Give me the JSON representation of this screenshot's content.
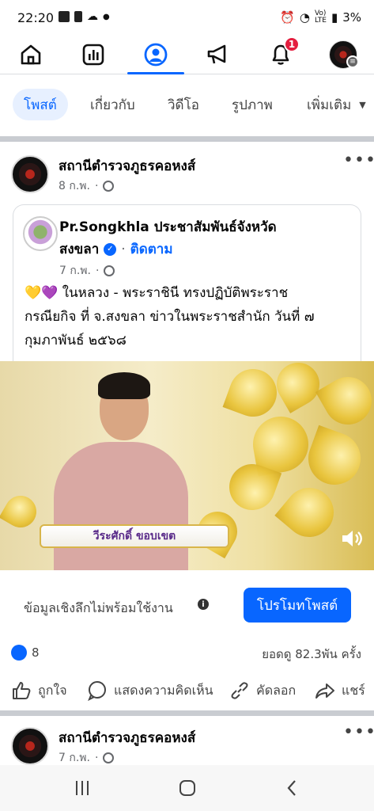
{
  "status_bar": {
    "time": "22:20",
    "battery": "3%"
  },
  "top_nav": {
    "items": [
      {
        "name": "home"
      },
      {
        "name": "dashboard"
      },
      {
        "name": "profile"
      },
      {
        "name": "ads"
      },
      {
        "name": "notifications",
        "badge": "1"
      },
      {
        "name": "menu"
      }
    ]
  },
  "profile_tabs": {
    "items": [
      "โพสต์",
      "เกี่ยวกับ",
      "วิดีโอ",
      "รูปภาพ",
      "เพิ่มเติม"
    ]
  },
  "post1": {
    "page_name": "สถานีตำรวจภูธรคอหงส์",
    "date": "8 ก.พ.",
    "shared": {
      "page_name_line1": "Pr.Songkhla ประชาสัมพันธ์จังหวัด",
      "page_name_line2": "สงขลา",
      "follow": "ติดตาม",
      "date": "7 ก.พ.",
      "text_line1": "💛💜 ในหลวง - พระราชินี ทรงปฏิบัติพระราช",
      "text_line2": "กรณียกิจ ที่ จ.สงขลา ข่าวในพระราชสำนัก วันที่ ๗",
      "text_line3": "กุมภาพันธ์ ๒๕๖๘"
    },
    "video": {
      "caption_name": "วีระศักดิ์ ขอบเขต"
    },
    "insight_text": "ข้อมูลเชิงลึกไม่พร้อมใช้งาน",
    "promote_label": "โปรโมทโพสต์",
    "like_count": "8",
    "views_text": "ยอดดู 82.3พัน ครั้ง",
    "actions": {
      "like": "ถูกใจ",
      "comment": "แสดงความคิดเห็น",
      "copy": "คัดลอก",
      "share": "แชร์"
    }
  },
  "post2": {
    "page_name": "สถานีตำรวจภูธรคอหงส์",
    "date": "7 ก.พ."
  },
  "colors": {
    "accent": "#0866ff",
    "badge": "#e41e3f"
  }
}
